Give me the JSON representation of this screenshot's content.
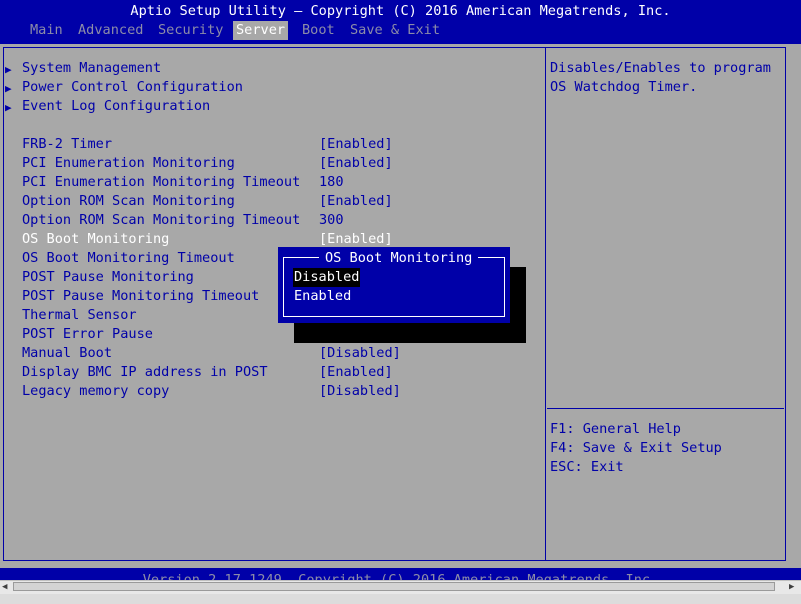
{
  "header": {
    "title": "Aptio Setup Utility – Copyright (C) 2016 American Megatrends, Inc.",
    "tabs": [
      "Main",
      "Advanced",
      "Security",
      "Server",
      "Boot",
      "Save & Exit"
    ],
    "active_tab": "Server"
  },
  "submenus": [
    "System Management",
    "Power Control Configuration",
    "Event Log Configuration"
  ],
  "settings": [
    {
      "label": "FRB-2 Timer",
      "value": "[Enabled]"
    },
    {
      "label": "PCI Enumeration Monitoring",
      "value": "[Enabled]"
    },
    {
      "label": "PCI Enumeration Monitoring Timeout",
      "value": "180"
    },
    {
      "label": "Option ROM Scan Monitoring",
      "value": "[Enabled]"
    },
    {
      "label": "Option ROM Scan Monitoring Timeout",
      "value": "300"
    },
    {
      "label": "OS Boot Monitoring",
      "value": "[Enabled]"
    },
    {
      "label": "OS Boot Monitoring Timeout",
      "value": ""
    },
    {
      "label": "POST Pause Monitoring",
      "value": ""
    },
    {
      "label": "POST Pause Monitoring Timeout",
      "value": ""
    },
    {
      "label": "Thermal Sensor",
      "value": ""
    },
    {
      "label": "POST Error Pause",
      "value": ""
    },
    {
      "label": "Manual Boot",
      "value": "[Disabled]"
    },
    {
      "label": "Display BMC IP address in POST",
      "value": "[Enabled]"
    },
    {
      "label": "Legacy memory copy",
      "value": "[Disabled]"
    }
  ],
  "help": {
    "description": [
      "Disables/Enables to program",
      "OS Watchdog Timer."
    ],
    "keys": [
      "F1: General Help",
      "F4: Save & Exit Setup",
      "ESC: Exit"
    ]
  },
  "popup": {
    "title": "OS Boot Monitoring",
    "options": [
      "Disabled",
      "Enabled"
    ],
    "selected_index": 0
  },
  "footer": {
    "text": "Version 2.17.1249. Copyright (C) 2016 American Megatrends, Inc."
  },
  "colors": {
    "background": "#a8a8a8",
    "accent_blue": "#0000a8",
    "highlight_text": "#ffffff"
  }
}
